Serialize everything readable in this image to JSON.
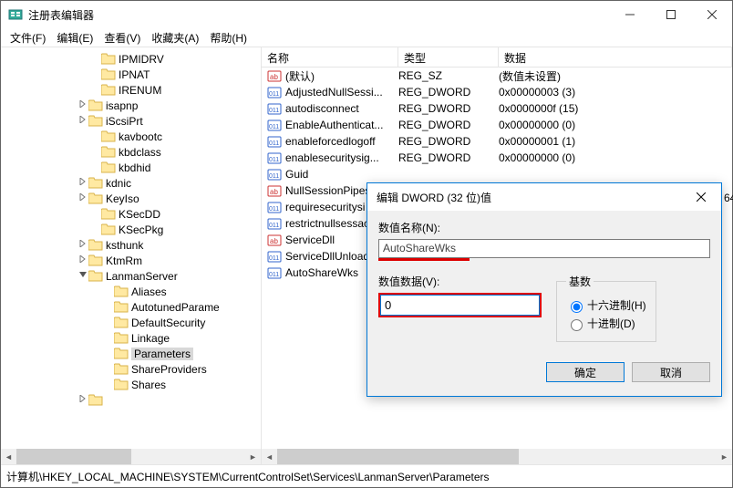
{
  "window": {
    "title": "注册表编辑器",
    "min": "—",
    "max": "☐",
    "close": "✕"
  },
  "menu": {
    "file": "文件(F)",
    "edit": "编辑(E)",
    "view": "查看(V)",
    "favorites": "收藏夹(A)",
    "help": "帮助(H)"
  },
  "tree": {
    "items": [
      {
        "indent": 7,
        "twisty": "",
        "label": "IPMIDRV"
      },
      {
        "indent": 7,
        "twisty": "",
        "label": "IPNAT"
      },
      {
        "indent": 7,
        "twisty": "",
        "label": "IRENUM"
      },
      {
        "indent": 6,
        "twisty": ">",
        "label": "isapnp"
      },
      {
        "indent": 6,
        "twisty": ">",
        "label": "iScsiPrt"
      },
      {
        "indent": 7,
        "twisty": "",
        "label": "kavbootc"
      },
      {
        "indent": 7,
        "twisty": "",
        "label": "kbdclass"
      },
      {
        "indent": 7,
        "twisty": "",
        "label": "kbdhid"
      },
      {
        "indent": 6,
        "twisty": ">",
        "label": "kdnic"
      },
      {
        "indent": 6,
        "twisty": ">",
        "label": "KeyIso"
      },
      {
        "indent": 7,
        "twisty": "",
        "label": "KSecDD"
      },
      {
        "indent": 7,
        "twisty": "",
        "label": "KSecPkg"
      },
      {
        "indent": 6,
        "twisty": ">",
        "label": "ksthunk"
      },
      {
        "indent": 6,
        "twisty": ">",
        "label": "KtmRm"
      },
      {
        "indent": 6,
        "twisty": "v",
        "label": "LanmanServer"
      },
      {
        "indent": 8,
        "twisty": "",
        "label": "Aliases"
      },
      {
        "indent": 8,
        "twisty": "",
        "label": "AutotunedParame"
      },
      {
        "indent": 8,
        "twisty": "",
        "label": "DefaultSecurity"
      },
      {
        "indent": 8,
        "twisty": "",
        "label": "Linkage"
      },
      {
        "indent": 8,
        "twisty": "",
        "label": "Parameters",
        "selected": true
      },
      {
        "indent": 8,
        "twisty": "",
        "label": "ShareProviders"
      },
      {
        "indent": 8,
        "twisty": "",
        "label": "Shares"
      },
      {
        "indent": 6,
        "twisty": ">",
        "label": ""
      }
    ]
  },
  "list": {
    "headers": {
      "name": "名称",
      "type": "类型",
      "data": "数据"
    },
    "rows": [
      {
        "icon": "sz",
        "name": "(默认)",
        "type": "REG_SZ",
        "data": "(数值未设置)"
      },
      {
        "icon": "dw",
        "name": "AdjustedNullSessi...",
        "type": "REG_DWORD",
        "data": "0x00000003 (3)"
      },
      {
        "icon": "dw",
        "name": "autodisconnect",
        "type": "REG_DWORD",
        "data": "0x0000000f (15)"
      },
      {
        "icon": "dw",
        "name": "EnableAuthenticat...",
        "type": "REG_DWORD",
        "data": "0x00000000 (0)"
      },
      {
        "icon": "dw",
        "name": "enableforcedlogoff",
        "type": "REG_DWORD",
        "data": "0x00000001 (1)"
      },
      {
        "icon": "dw",
        "name": "enablesecuritysig...",
        "type": "REG_DWORD",
        "data": "0x00000000 (0)"
      },
      {
        "icon": "dw",
        "name": "Guid",
        "type": "",
        "data": ""
      },
      {
        "icon": "sz",
        "name": "NullSessionPipes",
        "type": "",
        "data": ""
      },
      {
        "icon": "dw",
        "name": "requiresecuritysi",
        "type": "",
        "data": ""
      },
      {
        "icon": "dw",
        "name": "restrictnullsessac",
        "type": "",
        "data": ""
      },
      {
        "icon": "sz",
        "name": "ServiceDll",
        "type": "",
        "data": ""
      },
      {
        "icon": "dw",
        "name": "ServiceDllUnload",
        "type": "",
        "data": ""
      },
      {
        "icon": "dw",
        "name": "AutoShareWks",
        "type": "",
        "data": ""
      }
    ]
  },
  "dialog": {
    "title": "编辑 DWORD (32 位)值",
    "name_label": "数值名称(N):",
    "name_value": "AutoShareWks",
    "data_label": "数值数据(V):",
    "data_value": "0",
    "base_label": "基数",
    "hex_label": "十六进制(H)",
    "dec_label": "十进制(D)",
    "ok": "确定",
    "cancel": "取消",
    "close": "✕"
  },
  "overflow_text": "64",
  "statusbar": "计算机\\HKEY_LOCAL_MACHINE\\SYSTEM\\CurrentControlSet\\Services\\LanmanServer\\Parameters"
}
